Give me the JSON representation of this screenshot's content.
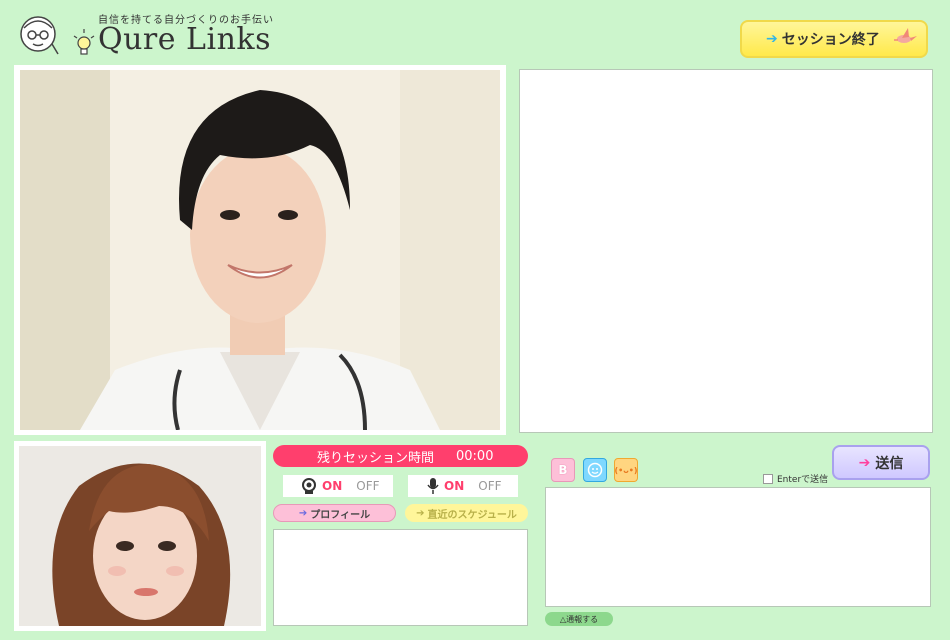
{
  "header": {
    "tagline": "自信を持てる自分づくりのお手伝い",
    "brand": "Qure Links",
    "end_session_label": "セッション終了"
  },
  "session": {
    "timer_label": "残りセッション時間",
    "timer_value": "00:00",
    "camera": {
      "on": "ON",
      "off": "OFF",
      "icon": "webcam-icon"
    },
    "mic": {
      "on": "ON",
      "off": "OFF",
      "icon": "microphone-icon"
    },
    "profile_label": "プロフィール",
    "schedule_label": "直近のスケジュール"
  },
  "compose": {
    "bold_label": "B",
    "kaomoji_label": "(•ᴗ•)",
    "enter_to_send": "Enterで送信",
    "send_label": "送信",
    "report_label": "△通報する"
  },
  "colors": {
    "background": "#ccf5cc",
    "accent_pink": "#ff3f6d",
    "accent_yellow": "#fff69a"
  }
}
